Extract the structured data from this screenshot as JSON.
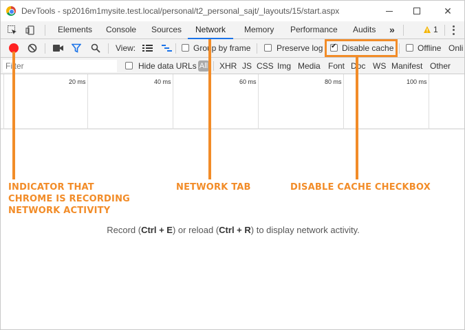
{
  "window": {
    "title": "DevTools - sp2016m1mysite.test.local/personal/t2_personal_sajt/_layouts/15/start.aspx"
  },
  "tabs": [
    {
      "label": "Elements"
    },
    {
      "label": "Console"
    },
    {
      "label": "Sources"
    },
    {
      "label": "Network",
      "active": true
    },
    {
      "label": "Memory"
    },
    {
      "label": "Performance"
    },
    {
      "label": "Audits"
    }
  ],
  "more_tabs": "»",
  "warnings": {
    "count": "1"
  },
  "network_toolbar": {
    "view_label": "View:",
    "group_by_frame": "Group by frame",
    "preserve_log": "Preserve log",
    "disable_cache": "Disable cache",
    "disable_cache_checked": true,
    "offline": "Offline",
    "online": "Onli"
  },
  "filter": {
    "placeholder": "Filter",
    "hide_data_urls": "Hide data URLs",
    "types": [
      "All",
      "XHR",
      "JS",
      "CSS",
      "Img",
      "Media",
      "Font",
      "Doc",
      "WS",
      "Manifest",
      "Other"
    ]
  },
  "timeline": {
    "labels": [
      "20 ms",
      "40 ms",
      "60 ms",
      "80 ms",
      "100 ms"
    ]
  },
  "empty_message": {
    "pre": "Record (",
    "key1": "Ctrl + E",
    "mid": ") or reload (",
    "key2": "Ctrl + R",
    "post": ") to display network activity."
  },
  "annotations": {
    "recording": "INDICATOR THAT CHROME IS RECORDING NETWORK ACTIVITY",
    "network_tab": "NETWORK TAB",
    "disable_cache": "DISABLE CACHE CHECKBOX"
  },
  "colors": {
    "annotation": "#f28c28",
    "record": "#ff2222",
    "active_tab": "#1a73e8"
  }
}
